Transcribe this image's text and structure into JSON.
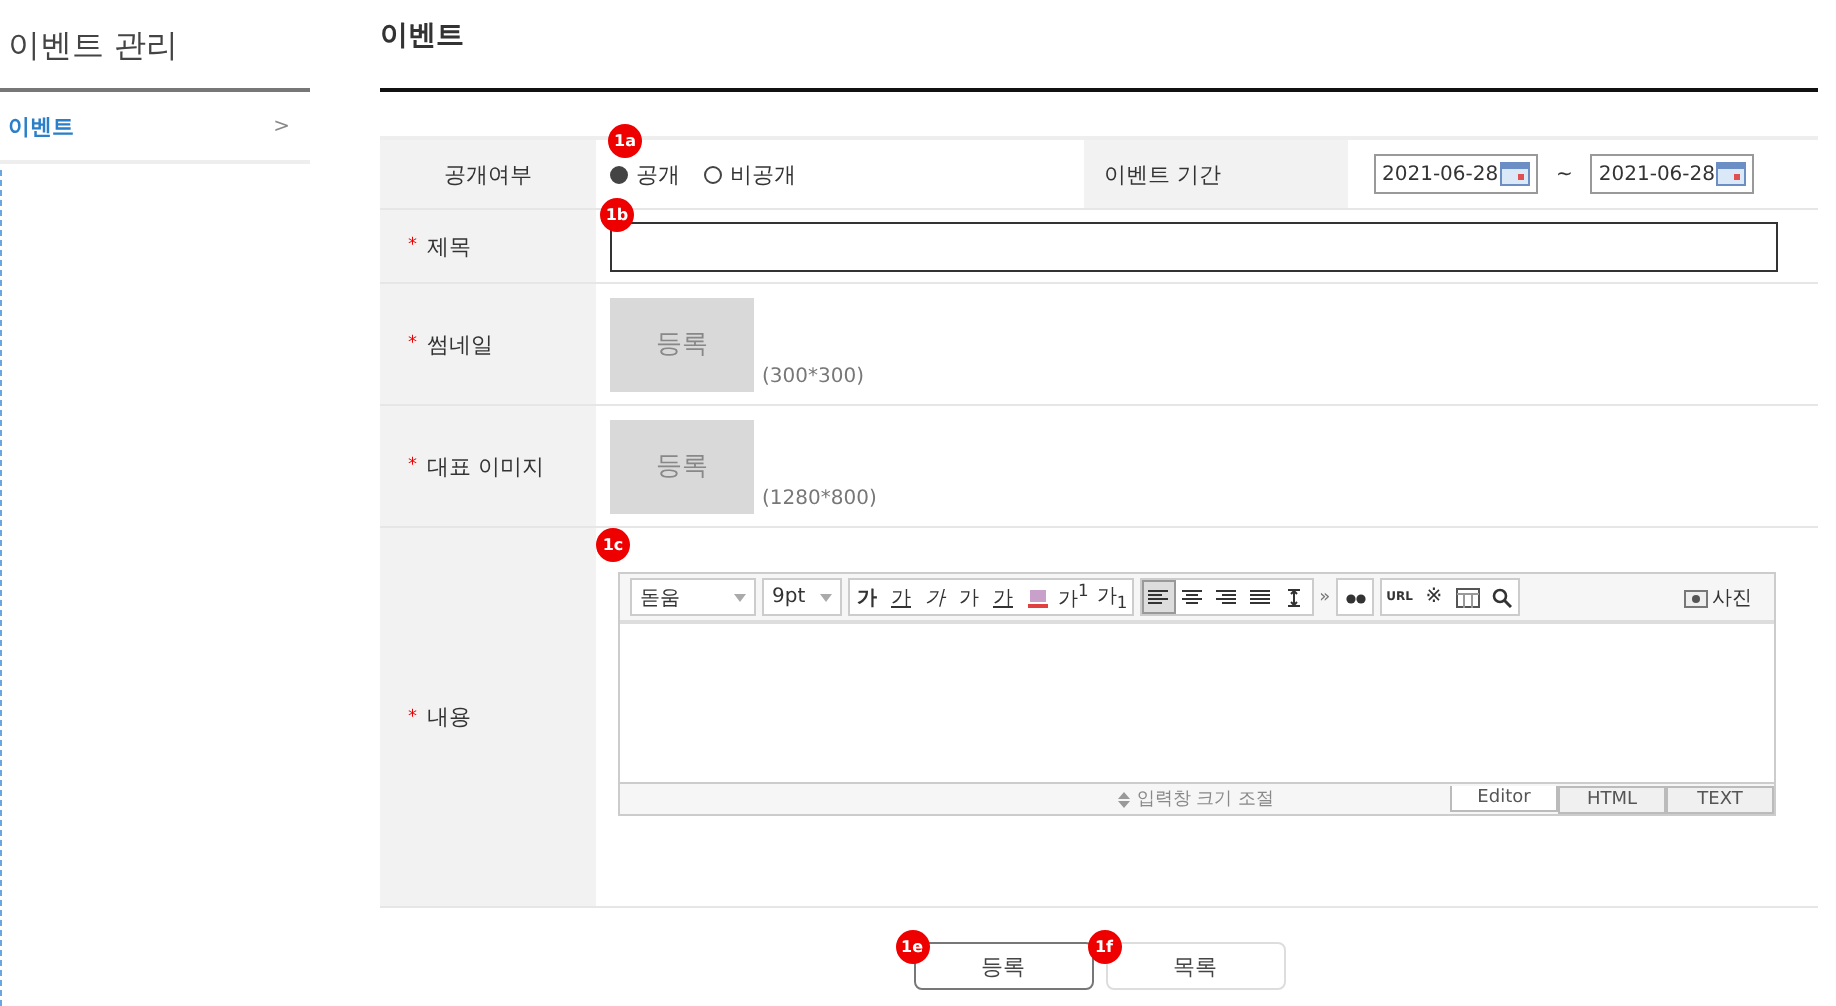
{
  "sidebar": {
    "title": "이벤트 관리",
    "items": [
      {
        "label": "이벤트",
        "arrow": ">",
        "selected": true
      }
    ]
  },
  "page": {
    "title": "이벤트"
  },
  "form": {
    "visibility": {
      "label": "공개여부",
      "marker": "1a",
      "options": [
        {
          "label": "공개",
          "selected": true
        },
        {
          "label": "비공개",
          "selected": false
        }
      ]
    },
    "period": {
      "label": "이벤트 기간",
      "start": "2021-06-28",
      "separator": "~",
      "end": "2021-06-28"
    },
    "title": {
      "label": "제목",
      "required_mark": "*",
      "marker": "1b"
    },
    "images": [
      {
        "label": "썸네일",
        "required_mark": "*",
        "button": "등록",
        "size": "(300*300)"
      },
      {
        "label": "대표 이미지",
        "required_mark": "*",
        "button": "등록",
        "size": "(1280*800)"
      }
    ],
    "content": {
      "label": "내용",
      "required_mark": "*",
      "marker": "1c",
      "editor": {
        "font": "돋움",
        "font_size": "9pt",
        "format_buttons": [
          {
            "kind": "bold",
            "label": "가"
          },
          {
            "kind": "underline",
            "label": "가"
          },
          {
            "kind": "italic",
            "label": "가"
          },
          {
            "kind": "plain",
            "label": "가"
          },
          {
            "kind": "color",
            "label": "가"
          },
          {
            "kind": "highlight"
          },
          {
            "kind": "plain",
            "label": "가$^{1}$"
          },
          {
            "kind": "plain",
            "label": "가$_{1}$"
          }
        ],
        "align_buttons": [
          {
            "kind": "left",
            "selected": true
          },
          {
            "kind": "center",
            "selected": false
          },
          {
            "kind": "right",
            "selected": false
          },
          {
            "kind": "justify",
            "selected": false
          },
          {
            "kind": "lineheight",
            "selected": false
          }
        ],
        "more": "»",
        "insert_buttons": [
          {
            "kind": "url",
            "label": "URL"
          },
          {
            "kind": "symbol",
            "label": "※"
          },
          {
            "kind": "table"
          },
          {
            "kind": "search"
          }
        ],
        "photo": "사진",
        "resize": "입력창 크기 조절",
        "modes": [
          {
            "label": "Editor",
            "selected": true
          },
          {
            "label": "HTML",
            "selected": false
          },
          {
            "label": "TEXT",
            "selected": false
          }
        ]
      }
    }
  },
  "actions": [
    {
      "label": "등록",
      "marker": "1e",
      "primary": true
    },
    {
      "label": "목록",
      "marker": "1f",
      "primary": false
    }
  ]
}
